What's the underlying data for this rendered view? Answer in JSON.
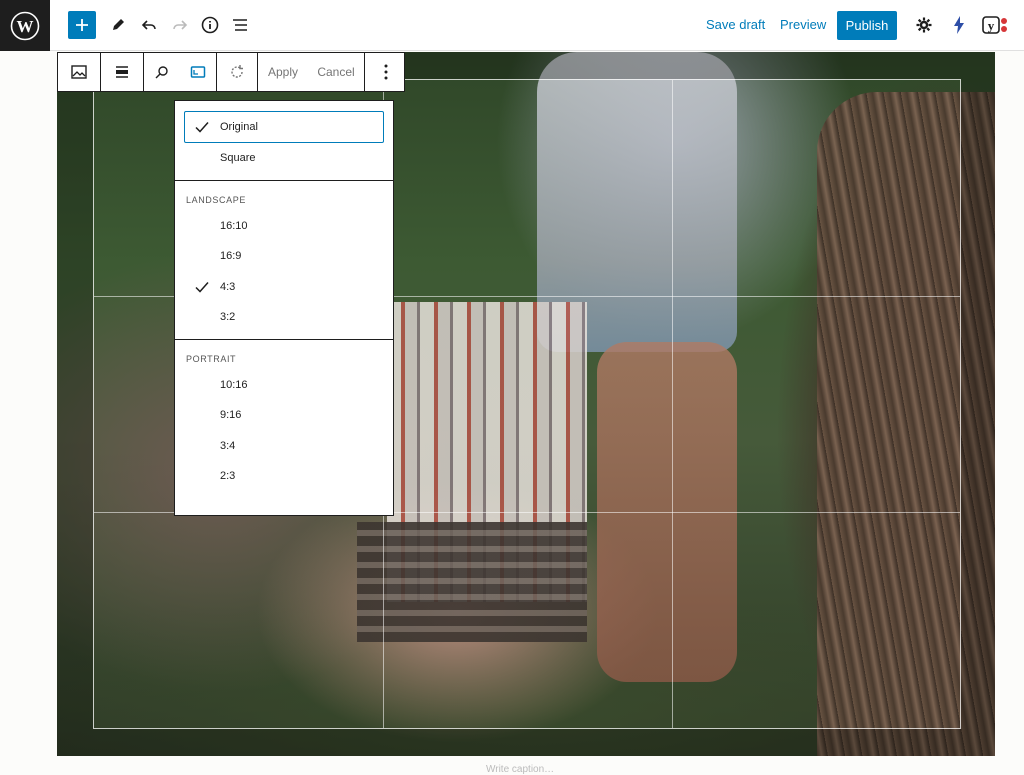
{
  "topbar": {
    "logo_icon": "wordpress-logo",
    "add_icon": "plus-icon",
    "tools_icon": "pencil-icon",
    "undo_icon": "undo-icon",
    "redo_icon": "redo-icon",
    "info_icon": "info-icon",
    "outline_icon": "list-view-icon",
    "save_draft": "Save draft",
    "preview": "Preview",
    "publish": "Publish",
    "settings_icon": "gear-icon",
    "jetpack_icon": "lightning-icon",
    "yoast_icon": "yoast-icon",
    "accent": "#007cba"
  },
  "block_toolbar": {
    "image_icon": "image-icon",
    "align_icon": "align-icon",
    "zoom_icon": "search-icon",
    "aspect_icon": "aspect-ratio-icon",
    "rotate_icon": "rotate-icon",
    "apply": "Apply",
    "cancel": "Cancel",
    "more_icon": "more-vertical-icon"
  },
  "aspect_menu": {
    "top_items": [
      {
        "label": "Original",
        "checked": true
      },
      {
        "label": "Square",
        "checked": false
      }
    ],
    "landscape_heading": "LANDSCAPE",
    "landscape": [
      {
        "label": "16:10",
        "checked": false
      },
      {
        "label": "16:9",
        "checked": false
      },
      {
        "label": "4:3",
        "checked": true
      },
      {
        "label": "3:2",
        "checked": false
      }
    ],
    "portrait_heading": "PORTRAIT",
    "portrait": [
      {
        "label": "10:16",
        "checked": false
      },
      {
        "label": "9:16",
        "checked": false
      },
      {
        "label": "3:4",
        "checked": false
      },
      {
        "label": "2:3",
        "checked": false
      }
    ]
  },
  "caption_hint": "Write caption…"
}
